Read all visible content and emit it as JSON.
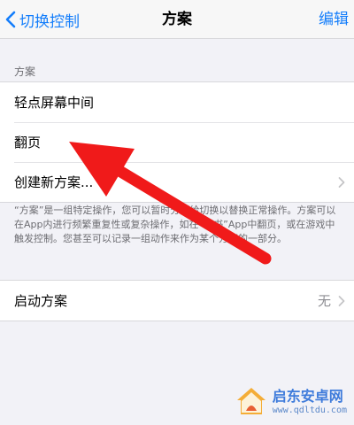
{
  "navbar": {
    "back_label": "切换控制",
    "title": "方案",
    "edit_label": "编辑"
  },
  "recipes": {
    "header": "方案",
    "items": [
      {
        "label": "轻点屏幕中间"
      },
      {
        "label": "翻页"
      },
      {
        "label": "创建新方案..."
      }
    ],
    "footnote": "“方案”是一组特定操作，您可以暂时分配给切换以替换正常操作。方案可以在App内进行频繁重复性或复杂操作，如在“图书”App中翻页，或在游戏中触发控制。您甚至可以记录一组动作来作为某个方案的一部分。"
  },
  "launch": {
    "label": "启动方案",
    "value": "无"
  },
  "watermark": {
    "title": "启东安卓网",
    "url": "www.qdltdu.com"
  },
  "colors": {
    "accent": "#147efb",
    "arrow": "#f01a1a"
  }
}
